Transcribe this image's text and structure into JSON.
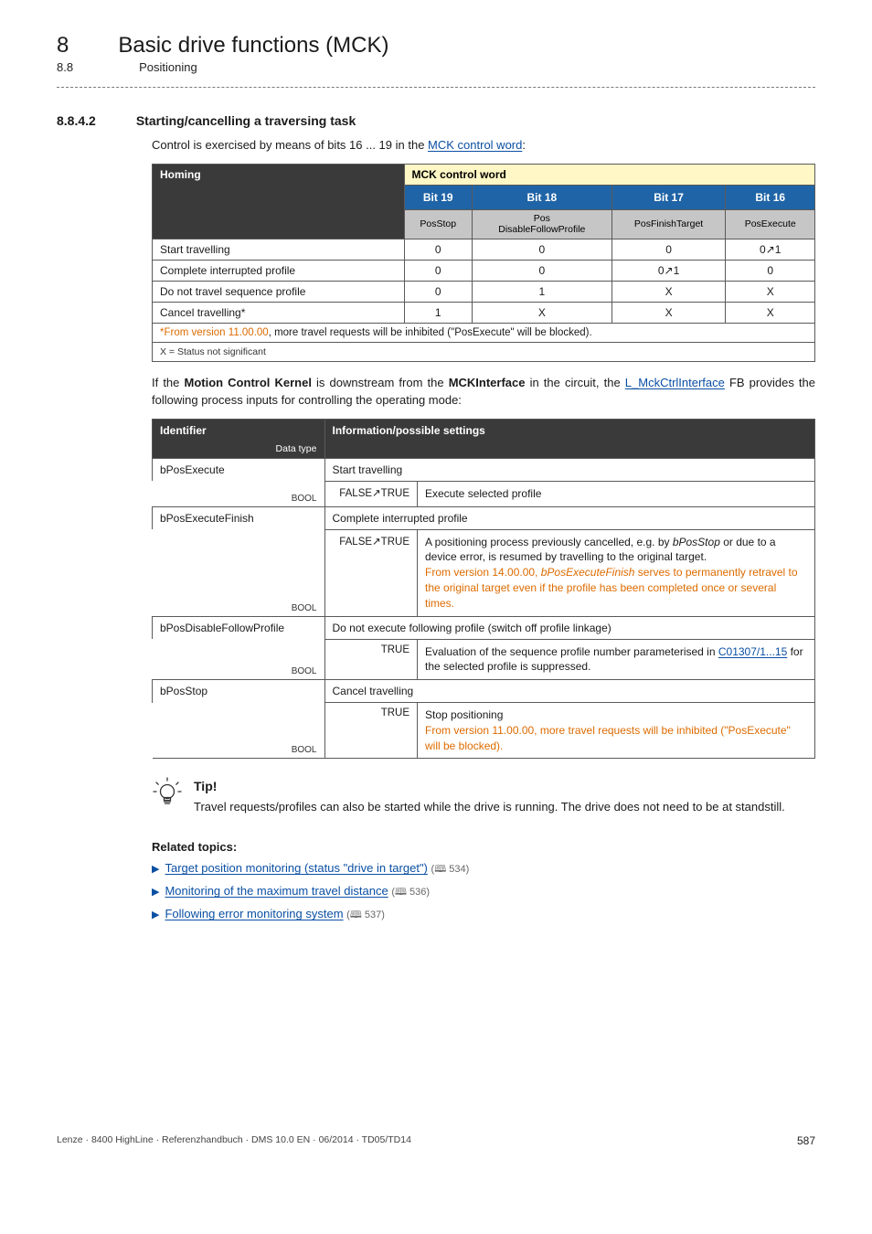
{
  "header": {
    "chapter_num": "8",
    "chapter_title": "Basic drive functions (MCK)",
    "sub_num": "8.8",
    "sub_title": "Positioning"
  },
  "section": {
    "num": "8.8.4.2",
    "title": "Starting/cancelling a traversing task"
  },
  "intro": {
    "prefix": "Control is exercised by means of bits 16 ... 19 in the ",
    "link": "MCK control word",
    "suffix": ":"
  },
  "table1": {
    "hdr_left": "Homing",
    "hdr_right": "MCK control word",
    "bits": [
      "Bit 19",
      "Bit 18",
      "Bit 17",
      "Bit 16"
    ],
    "bitdesc": [
      "PosStop",
      "Pos\nDisableFollowProfile",
      "PosFinishTarget",
      "PosExecute"
    ],
    "rows": [
      {
        "name": "Start travelling",
        "c": [
          "0",
          "0",
          "0",
          "0↗1"
        ]
      },
      {
        "name": "Complete interrupted profile",
        "c": [
          "0",
          "0",
          "0↗1",
          "0"
        ]
      },
      {
        "name": "Do not travel sequence profile",
        "c": [
          "0",
          "1",
          "X",
          "X"
        ]
      },
      {
        "name": "Cancel travelling*",
        "c": [
          "1",
          "X",
          "X",
          "X"
        ]
      }
    ],
    "note_star": "*",
    "note_prefix": "From version 11.00.00",
    "note_suffix": ", more travel requests will be inhibited (\"PosExecute\" will be blocked).",
    "legend": "X = Status not significant"
  },
  "para2": {
    "p1": "If the ",
    "b1": "Motion Control Kernel",
    "p2": " is downstream from the ",
    "b2": "MCKInterface",
    "p3": " in the circuit, the ",
    "link": "L_MckCtrlInterface",
    "p4": " FB provides the following process inputs for controlling the operating mode:"
  },
  "table2": {
    "hdr_ident": "Identifier",
    "hdr_dtype": "Data type",
    "hdr_info": "Information/possible settings",
    "rows": [
      {
        "ident": "bPosExecute",
        "dtype": "BOOL",
        "info_top": "Start travelling",
        "sub": [
          {
            "key": "FALSE↗TRUE",
            "val_plain": "Execute selected profile"
          }
        ]
      },
      {
        "ident": "bPosExecuteFinish",
        "dtype": "BOOL",
        "info_top": "Complete interrupted profile",
        "sub": [
          {
            "key": "FALSE↗TRUE",
            "val_line1": "A positioning process previously cancelled, e.g. by ",
            "val_ital1": "bPosStop",
            "val_line1b": " or due to a device error, is resumed by travelling to the original target.",
            "val_orange_pre": "From version 14.00.00",
            "val_orange_mid": ", ",
            "val_ital2": "bPosExecuteFinish",
            "val_orange_post": " serves to permanently retravel to the original target even if the profile has been completed once or several times."
          }
        ]
      },
      {
        "ident": "bPosDisableFollowProfile",
        "dtype": "BOOL",
        "info_top": "Do not execute following profile (switch off profile linkage)",
        "sub": [
          {
            "key": "TRUE",
            "val_line1": "Evaluation of the sequence profile number parameterised in ",
            "val_link": "C01307/1...15",
            "val_line1b": " for the selected profile is suppressed."
          }
        ]
      },
      {
        "ident": "bPosStop",
        "dtype": "BOOL",
        "info_top": "Cancel travelling",
        "sub": [
          {
            "key": "TRUE",
            "val_line1": "Stop positioning",
            "val_orange_pre": "From version 11.00.00",
            "val_orange_post": ", more travel requests will be inhibited (\"PosExecute\" will be blocked)."
          }
        ]
      }
    ]
  },
  "tip": {
    "heading": "Tip!",
    "text": "Travel requests/profiles can also be started while the drive is running. The drive does not need to be at standstill."
  },
  "related": {
    "heading": "Related topics:",
    "items": [
      {
        "text": "Target position monitoring (status \"drive in target\")",
        "page": "534"
      },
      {
        "text": "Monitoring of the maximum travel distance",
        "page": "536"
      },
      {
        "text": "Following error monitoring system",
        "page": "537"
      }
    ]
  },
  "footer": {
    "left": "Lenze · 8400 HighLine · Referenzhandbuch · DMS 10.0 EN · 06/2014 · TD05/TD14",
    "page": "587"
  }
}
